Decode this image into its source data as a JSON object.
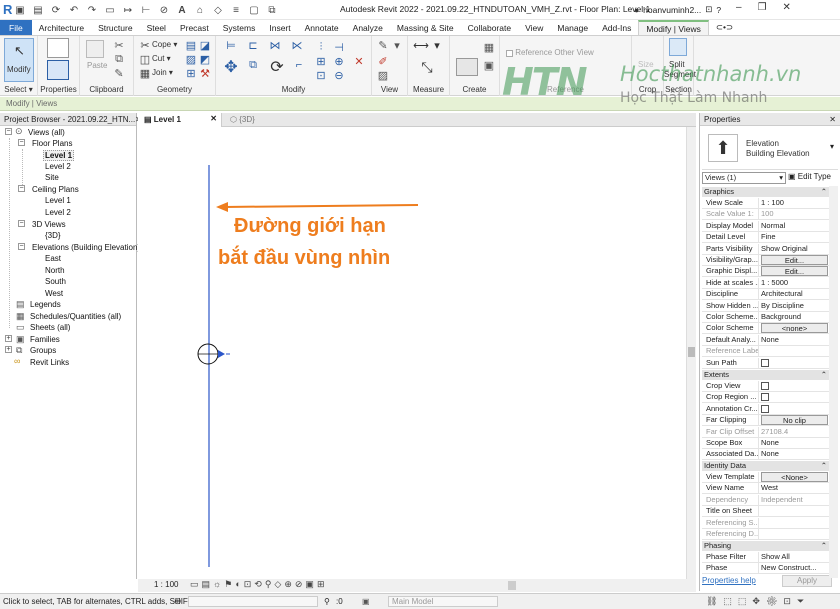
{
  "app": {
    "title": "Autodesk Revit 2022 - 2021.09.22_HTNDUTOAN_VMH_Z.rvt - Floor Plan: Level 1",
    "user": "hoanvuminh2...",
    "logo_letter": "R"
  },
  "ribbon_tabs": [
    "File",
    "Architecture",
    "Structure",
    "Steel",
    "Precast",
    "Systems",
    "Insert",
    "Annotate",
    "Analyze",
    "Massing & Site",
    "Collaborate",
    "View",
    "Manage",
    "Add-Ins",
    "Modify | Views"
  ],
  "ribbon": {
    "modify_label": "Modify",
    "select_label": "Select",
    "properties_label": "Properties",
    "paste_label": "Paste",
    "clipboard_label": "Clipboard",
    "cope_label": "Cope",
    "cut_label": "Cut",
    "join_label": "Join",
    "geometry_label": "Geometry",
    "modify_panel_label": "Modify",
    "view_panel_label": "View",
    "measure_label": "Measure",
    "create_label": "Create",
    "reference_other_view": "Reference Other View",
    "reference_label": "Reference",
    "size_label": "Size",
    "crop_label": "Crop",
    "split_label": "Split",
    "segment_label": "Segment",
    "section_label": "Section"
  },
  "option_bar": {
    "text": "Modify | Views"
  },
  "watermark": {
    "brand": "HTN",
    "site": "Hocthatnhanh.vn",
    "slogan": "Học Thật  Làm Nhanh"
  },
  "project_browser": {
    "title": "Project Browser - 2021.09.22_HTN...",
    "items": {
      "views_all": "Views (all)",
      "floor_plans": "Floor Plans",
      "fp_level1": "Level 1",
      "fp_level2": "Level 2",
      "fp_site": "Site",
      "ceiling_plans": "Ceiling Plans",
      "cp_level1": "Level 1",
      "cp_level2": "Level 2",
      "views_3d": "3D Views",
      "v3d": "{3D}",
      "elevations": "Elevations (Building Elevation)",
      "east": "East",
      "north": "North",
      "south": "South",
      "west": "West",
      "legends": "Legends",
      "schedules": "Schedules/Quantities (all)",
      "sheets": "Sheets (all)",
      "families": "Families",
      "groups": "Groups",
      "revit_links": "Revit Links"
    }
  },
  "view_tabs": [
    "Level 1",
    "{3D}"
  ],
  "annotation": {
    "line1": "Đường giới hạn",
    "line2": "bắt đầu vùng nhìn",
    "color": "#ee7d1e"
  },
  "view_bar": {
    "scale": "1 : 100"
  },
  "properties": {
    "title": "Properties",
    "type_line1": "Elevation",
    "type_line2": "Building Elevation",
    "views_selector": "Views (1)",
    "edit_type": "Edit Type",
    "groups": {
      "graphics": "Graphics",
      "extents": "Extents",
      "identity": "Identity Data",
      "phasing": "Phasing"
    },
    "graphics": [
      {
        "k": "View Scale",
        "v": "1 : 100"
      },
      {
        "k": "Scale Value  1:",
        "v": "100"
      },
      {
        "k": "Display Model",
        "v": "Normal"
      },
      {
        "k": "Detail Level",
        "v": "Fine"
      },
      {
        "k": "Parts Visibility",
        "v": "Show Original"
      },
      {
        "k": "Visibility/Grap...",
        "v": "Edit..."
      },
      {
        "k": "Graphic Displ...",
        "v": "Edit..."
      },
      {
        "k": "Hide at scales ...",
        "v": "1 : 5000"
      },
      {
        "k": "Discipline",
        "v": "Architectural"
      },
      {
        "k": "Show Hidden ...",
        "v": "By Discipline"
      },
      {
        "k": "Color Scheme...",
        "v": "Background"
      },
      {
        "k": "Color Scheme",
        "v": "<none>"
      },
      {
        "k": "Default Analy...",
        "v": "None"
      },
      {
        "k": "Reference Label",
        "v": ""
      },
      {
        "k": "Sun Path",
        "v": ""
      }
    ],
    "extents": [
      {
        "k": "Crop View",
        "v": ""
      },
      {
        "k": "Crop Region ...",
        "v": ""
      },
      {
        "k": "Annotation Cr...",
        "v": ""
      },
      {
        "k": "Far Clipping",
        "v": "No clip"
      },
      {
        "k": "Far Clip Offset",
        "v": "27108.4"
      },
      {
        "k": "Scope Box",
        "v": "None"
      },
      {
        "k": "Associated Da...",
        "v": "None"
      }
    ],
    "identity": [
      {
        "k": "View Template",
        "v": "<None>"
      },
      {
        "k": "View Name",
        "v": "West"
      },
      {
        "k": "Dependency",
        "v": "Independent"
      },
      {
        "k": "Title on Sheet",
        "v": ""
      },
      {
        "k": "Referencing S...",
        "v": ""
      },
      {
        "k": "Referencing D...",
        "v": ""
      }
    ],
    "phasing": [
      {
        "k": "Phase Filter",
        "v": "Show All"
      },
      {
        "k": "Phase",
        "v": "New Construct..."
      }
    ],
    "help_link": "Properties help",
    "apply": "Apply"
  },
  "status_bar": {
    "text": "Click to select, TAB for alternates, CTRL adds, SHIF",
    "count": ":0",
    "model": "Main Model"
  }
}
